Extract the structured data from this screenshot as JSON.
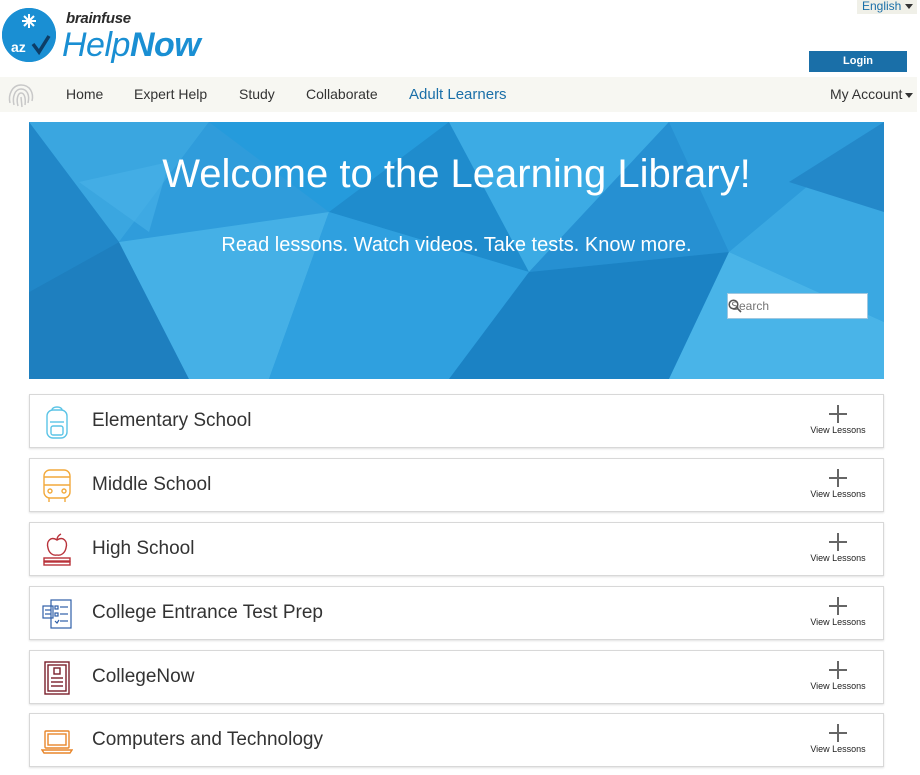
{
  "header": {
    "brand": "brainfuse",
    "product_light": "Help",
    "product_bold": "Now",
    "language": "English",
    "login_label": "Login"
  },
  "nav": {
    "items": [
      {
        "label": "Home"
      },
      {
        "label": "Expert Help"
      },
      {
        "label": "Study"
      },
      {
        "label": "Collaborate"
      },
      {
        "label": "Adult Learners"
      }
    ],
    "account_label": "My Account"
  },
  "hero": {
    "title": "Welcome to the Learning Library!",
    "subtitle": "Read lessons. Watch videos. Take tests. Know more.",
    "search_placeholder": "Search"
  },
  "categories": [
    {
      "label": "Elementary School",
      "action": "View Lessons",
      "icon": "backpack-icon",
      "color": "#5bc4e6"
    },
    {
      "label": "Middle School",
      "action": "View Lessons",
      "icon": "bus-icon",
      "color": "#f2a93b"
    },
    {
      "label": "High School",
      "action": "View Lessons",
      "icon": "apple-books-icon",
      "color": "#b8323a"
    },
    {
      "label": "College Entrance Test Prep",
      "action": "View Lessons",
      "icon": "test-sheet-icon",
      "color": "#2f5fa8"
    },
    {
      "label": "CollegeNow",
      "action": "View Lessons",
      "icon": "notebook-icon",
      "color": "#7a1f2b"
    },
    {
      "label": "Computers and Technology",
      "action": "View Lessons",
      "icon": "laptop-icon",
      "color": "#e8862a"
    }
  ],
  "colors": {
    "accent": "#1a6fa8",
    "hero_blue": "#2a9ad8",
    "logo_blue": "#1a8fd3"
  }
}
